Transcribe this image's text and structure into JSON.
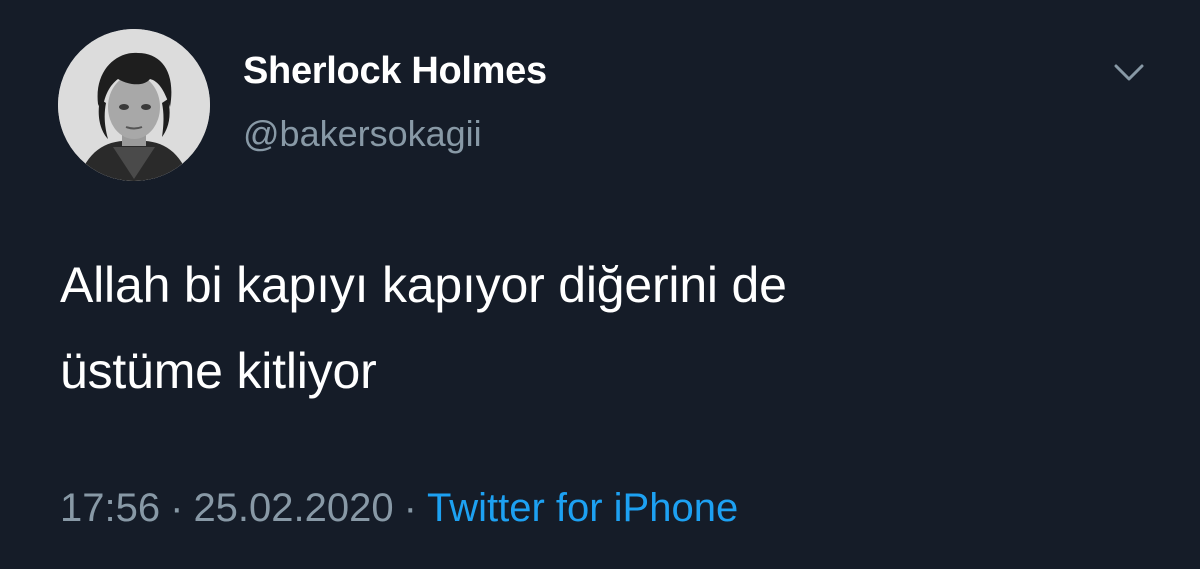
{
  "user": {
    "display_name": "Sherlock Holmes",
    "handle": "@bakersokagii",
    "avatar_icon": "profile-avatar"
  },
  "tweet": {
    "lines": [
      "Allah bi kapıyı kapıyor diğerini de",
      "üstüme kitliyor"
    ]
  },
  "meta": {
    "time": "17:56",
    "separator": "·",
    "date": "25.02.2020",
    "source": "Twitter for iPhone"
  },
  "icons": {
    "menu": "chevron-down-icon"
  },
  "colors": {
    "background": "#151c28",
    "primary_text": "#ffffff",
    "secondary_text": "#8899a6",
    "link": "#1da1f2"
  }
}
